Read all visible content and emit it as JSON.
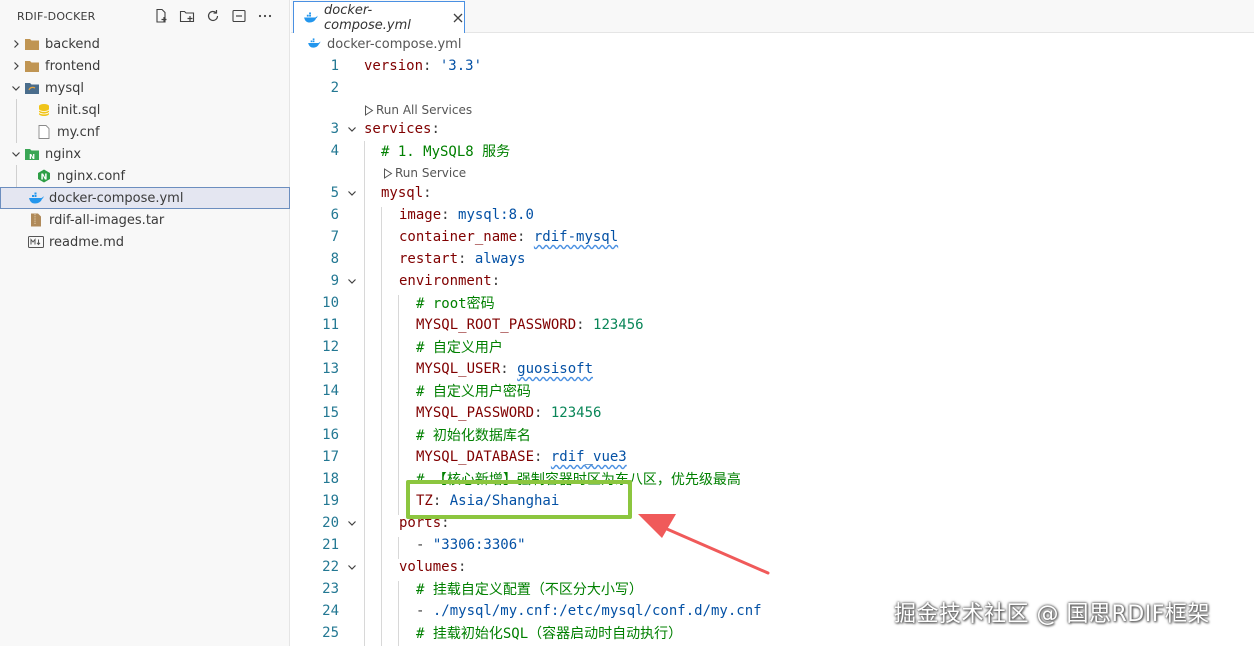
{
  "explorer": {
    "title": "RDIF-DOCKER",
    "actions": [
      "new-file-icon",
      "new-folder-icon",
      "refresh-icon",
      "collapse-all-icon",
      "more-icon"
    ],
    "items": [
      {
        "label": "backend",
        "type": "folder",
        "depth": 0,
        "expanded": false
      },
      {
        "label": "frontend",
        "type": "folder",
        "depth": 0,
        "expanded": false
      },
      {
        "label": "mysql",
        "type": "folder",
        "depth": 0,
        "expanded": true
      },
      {
        "label": "init.sql",
        "type": "file",
        "depth": 1
      },
      {
        "label": "my.cnf",
        "type": "file",
        "depth": 1
      },
      {
        "label": "nginx",
        "type": "folder",
        "depth": 0,
        "expanded": true
      },
      {
        "label": "nginx.conf",
        "type": "file",
        "depth": 1
      },
      {
        "label": "docker-compose.yml",
        "type": "file",
        "depth": 0,
        "selected": true
      },
      {
        "label": "rdif-all-images.tar",
        "type": "file",
        "depth": 0
      },
      {
        "label": "readme.md",
        "type": "file",
        "depth": 0
      }
    ]
  },
  "tab": {
    "label": "docker-compose.yml",
    "close": "×"
  },
  "breadcrumb": {
    "file": "docker-compose.yml"
  },
  "codelens": {
    "run_all": "Run All Services",
    "run_service": "Run Service"
  },
  "lines": [
    {
      "n": "1",
      "key": "version",
      "val": "'3.3'"
    },
    {
      "n": "2"
    },
    {
      "n": "3",
      "key": "services"
    },
    {
      "n": "4",
      "comment": "# 1. MySQL8 服务"
    },
    {
      "n": "5",
      "key": "mysql"
    },
    {
      "n": "6",
      "key": "image",
      "val": "mysql:8.0"
    },
    {
      "n": "7",
      "key": "container_name",
      "val": "rdif-mysql"
    },
    {
      "n": "8",
      "key": "restart",
      "val": "always"
    },
    {
      "n": "9",
      "key": "environment"
    },
    {
      "n": "10",
      "comment": "# root密码"
    },
    {
      "n": "11",
      "key": "MYSQL_ROOT_PASSWORD",
      "val": "123456"
    },
    {
      "n": "12",
      "comment": "# 自定义用户"
    },
    {
      "n": "13",
      "key": "MYSQL_USER",
      "val": "guosisoft"
    },
    {
      "n": "14",
      "comment": "# 自定义用户密码"
    },
    {
      "n": "15",
      "key": "MYSQL_PASSWORD",
      "val": "123456"
    },
    {
      "n": "16",
      "comment": "# 初始化数据库名"
    },
    {
      "n": "17",
      "key": "MYSQL_DATABASE",
      "val": "rdif_vue3"
    },
    {
      "n": "18",
      "comment": "# 【核心新增】强制容器时区为东八区，优先级最高"
    },
    {
      "n": "19",
      "key": "TZ",
      "val": "Asia/Shanghai"
    },
    {
      "n": "20",
      "key": "ports"
    },
    {
      "n": "21",
      "val": "\"3306:3306\""
    },
    {
      "n": "22",
      "key": "volumes"
    },
    {
      "n": "23",
      "comment": "# 挂载自定义配置（不区分大小写）"
    },
    {
      "n": "24",
      "val": "./mysql/my.cnf:/etc/mysql/conf.d/my.cnf"
    },
    {
      "n": "25",
      "comment": "# 挂载初始化SQL（容器启动时自动执行）"
    }
  ],
  "watermark": "掘金技术社区 @ 国思RDIF框架"
}
